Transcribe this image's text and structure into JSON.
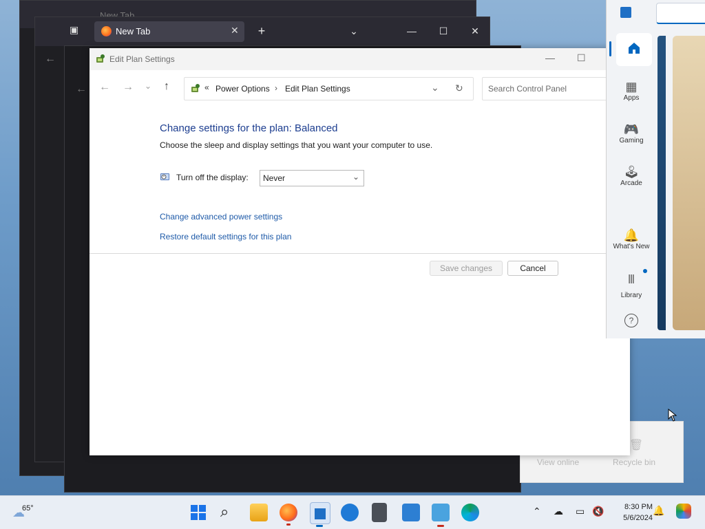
{
  "background_windows": {
    "tab_back": "New Tab",
    "tab_front": "New Tab",
    "bottom_labels": [
      "View online",
      "Recycle bin"
    ]
  },
  "control_panel": {
    "title": "Edit Plan Settings",
    "breadcrumb": {
      "overflow": "«",
      "items": [
        "Power Options",
        "Edit Plan Settings"
      ]
    },
    "search_placeholder": "Search Control Panel",
    "heading": "Change settings for the plan: Balanced",
    "subheading": "Choose the sleep and display settings that you want your computer to use.",
    "display_label": "Turn off the display:",
    "display_value": "Never",
    "link_advanced": "Change advanced power settings",
    "link_restore": "Restore default settings for this plan",
    "save_label": "Save changes",
    "cancel_label": "Cancel"
  },
  "store": {
    "nav": [
      {
        "label": "Apps",
        "icon": "apps-icon"
      },
      {
        "label": "Gaming",
        "icon": "gamepad-icon"
      },
      {
        "label": "Arcade",
        "icon": "joystick-icon"
      },
      {
        "label": "What's New",
        "icon": "bell-sparkle-icon"
      },
      {
        "label": "Library",
        "icon": "library-icon"
      }
    ],
    "accent": "#0067c0"
  },
  "taskbar": {
    "weather_temp": "65°",
    "time": "8:30 PM",
    "date": "5/6/2024"
  }
}
